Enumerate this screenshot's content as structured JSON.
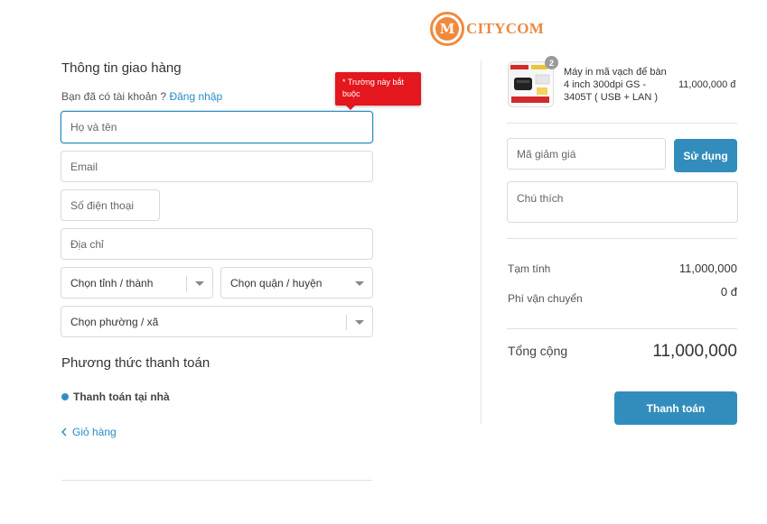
{
  "brand": {
    "logo_letter": "M",
    "name": "CITYCOM"
  },
  "shipping": {
    "title": "Thông tin giao hàng",
    "account_prompt": "Bạn đã có tài khoản ?",
    "login_link": "Đăng nhập",
    "required_tooltip": "* Trường này bắt buộc",
    "fields": {
      "name_placeholder": "Họ và tên",
      "email_placeholder": "Email",
      "phone_placeholder": "Số điện thoại",
      "address_placeholder": "Địa chỉ"
    },
    "selects": {
      "province": "Chọn tỉnh / thành",
      "district": "Chọn quận / huyện",
      "ward": "Chọn phường / xã"
    }
  },
  "payment": {
    "title": "Phương thức thanh toán",
    "option_label": "Thanh toán tại nhà",
    "option_selected": true
  },
  "back_link": "Giỏ hàng",
  "order": {
    "item": {
      "quantity": "2",
      "name": "Máy in mã vạch để bàn 4 inch 300dpi GS - 3405T ( USB + LAN )",
      "price": "11,000,000 đ"
    },
    "discount_placeholder": "Mã giảm giá",
    "apply_button": "Sử dụng",
    "note_placeholder": "Chú thích",
    "subtotal_label": "Tạm tính",
    "subtotal_value": "11,000,000",
    "shipping_label": "Phí vận chuyển",
    "shipping_value": "0 đ",
    "total_label": "Tổng cộng",
    "total_value": "11,000,000",
    "checkout_button": "Thanh toán"
  },
  "colors": {
    "accent": "#338dbc",
    "brand": "#f08a3c",
    "error": "#e4161e"
  }
}
